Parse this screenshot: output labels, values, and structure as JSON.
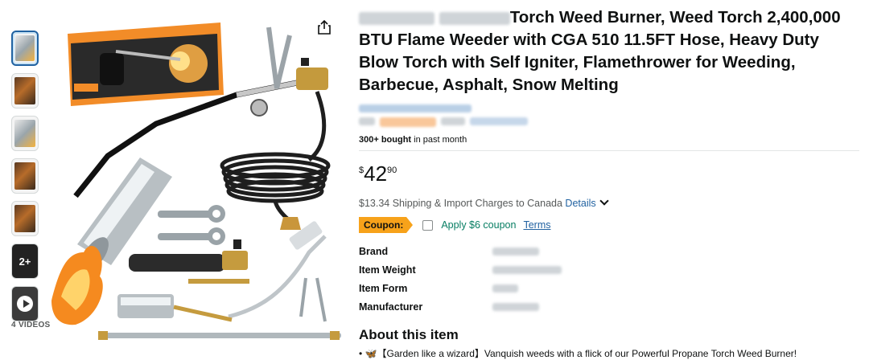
{
  "gallery": {
    "thumbnails": [
      {
        "name": "thumbnail-1",
        "style": "light"
      },
      {
        "name": "thumbnail-2",
        "style": "dark"
      },
      {
        "name": "thumbnail-3",
        "style": "light"
      },
      {
        "name": "thumbnail-4",
        "style": "dark"
      },
      {
        "name": "thumbnail-5",
        "style": "dark"
      }
    ],
    "more_label": "2+",
    "videos_label": "4 VIDEOS",
    "share_icon": "share-icon"
  },
  "product": {
    "title_visible": "Torch Weed Burner, Weed Torch 2,400,000 BTU Flame Weeder with CGA 510 11.5FT Hose, Heavy Duty Blow Torch with Self Igniter, Flamethrower for Weeding, Barbecue, Asphalt, Snow Melting",
    "bought_bold": "300+ bought",
    "bought_rest": " in past month",
    "price": {
      "symbol": "$",
      "whole": "42",
      "fraction": "90"
    },
    "shipping_text": "$13.34 Shipping & Import Charges to Canada ",
    "details_label": "Details",
    "coupon": {
      "badge": "Coupon:",
      "apply_text": "Apply $6 coupon",
      "terms_label": "Terms"
    },
    "specs": [
      {
        "label": "Brand"
      },
      {
        "label": "Item Weight"
      },
      {
        "label": "Item Form"
      },
      {
        "label": "Manufacturer"
      }
    ],
    "about_heading": "About this item",
    "first_bullet": "【Garden like a wizard】Vanquish weeds with a flick of our Powerful Propane Torch Weed Burner!"
  },
  "colors": {
    "accent_link": "#2162a1",
    "coupon_badge": "#f7a21a",
    "apply_green": "#067d62"
  }
}
